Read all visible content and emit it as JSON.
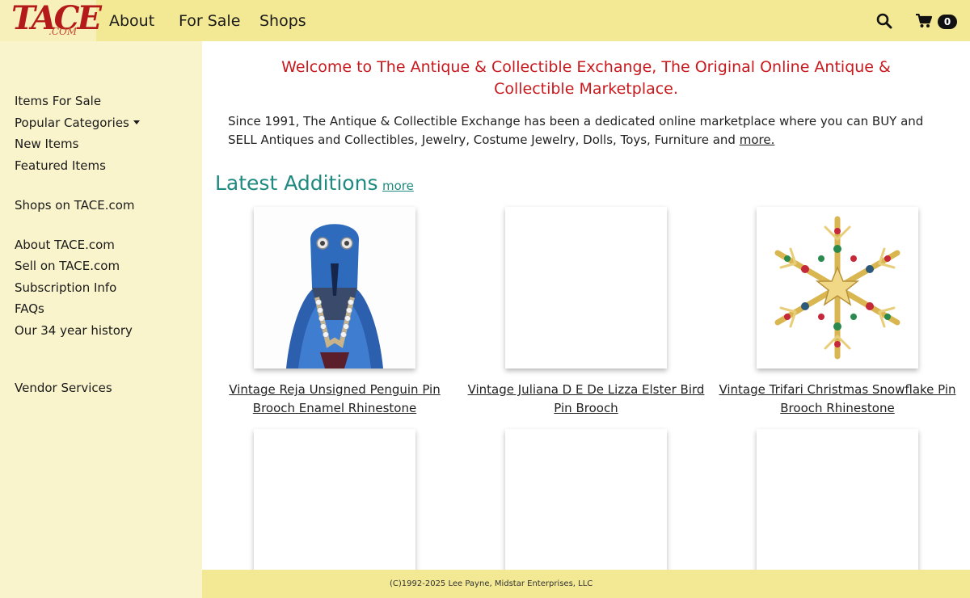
{
  "header": {
    "logo_main": "TACE",
    "logo_sub": ".COM",
    "nav": [
      "About",
      "For Sale",
      "Shops"
    ],
    "cart_count": "0"
  },
  "sidebar": {
    "items": [
      "Items For Sale",
      "Popular Categories",
      "New Items",
      "Featured Items",
      "Shops on TACE.com",
      "About TACE.com",
      "Sell on TACE.com",
      "Subscription Info",
      "FAQs",
      "Our 34 year history",
      "Vendor Services"
    ]
  },
  "main": {
    "welcome": "Welcome to The Antique & Collectible Exchange, The Original Online Antique & Collectible Marketplace.",
    "intro": "Since 1991, The Antique & Collectible Exchange has been a dedicated online marketplace where you can BUY and SELL Antiques and Collectibles, Jewelry, Costume Jewelry, Dolls, Toys, Furniture and",
    "intro_more": "more.",
    "latest_title": "Latest Additions",
    "latest_more": "more",
    "items": [
      {
        "title": "Vintage Reja Unsigned Penguin Pin Brooch Enamel Rhinestone"
      },
      {
        "title": "Vintage Juliana D E De Lizza Elster Bird Pin Brooch"
      },
      {
        "title": "Vintage Trifari Christmas Snowflake Pin Brooch Rhinestone"
      }
    ]
  },
  "footer": {
    "copyright": "(C)1992-2025 Lee Payne, Midstar Enterprises, LLC"
  },
  "colors": {
    "topbar": "#f3e995",
    "sidebar": "#f9f4cc",
    "accent_red": "#c8191d",
    "accent_teal": "#1f8a7f"
  },
  "icons": [
    "search-icon",
    "cart-icon",
    "caret-down-icon"
  ]
}
